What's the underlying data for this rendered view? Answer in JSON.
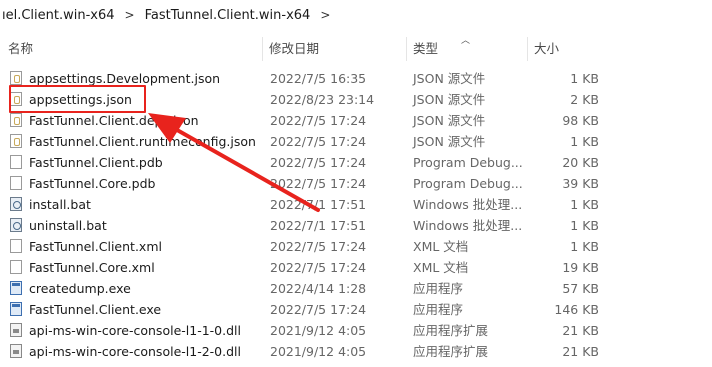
{
  "breadcrumb": {
    "items": [
      "ıel.Client.win-x64",
      "FastTunnel.Client.win-x64"
    ],
    "separators": [
      ">",
      ">"
    ]
  },
  "columns": {
    "name": "名称",
    "date": "修改日期",
    "type": "类型",
    "size": "大小"
  },
  "files": [
    {
      "name": "appsettings.Development.json",
      "date": "2022/7/5 16:35",
      "type": "JSON 源文件",
      "size": "1 KB",
      "icon": "json-file-icon"
    },
    {
      "name": "appsettings.json",
      "date": "2022/8/23 23:14",
      "type": "JSON 源文件",
      "size": "2 KB",
      "icon": "json-file-icon"
    },
    {
      "name": "FastTunnel.Client.deps.json",
      "date": "2022/7/5 17:24",
      "type": "JSON 源文件",
      "size": "98 KB",
      "icon": "json-file-icon"
    },
    {
      "name": "FastTunnel.Client.runtimeconfig.json",
      "date": "2022/7/5 17:24",
      "type": "JSON 源文件",
      "size": "1 KB",
      "icon": "json-file-icon"
    },
    {
      "name": "FastTunnel.Client.pdb",
      "date": "2022/7/5 17:24",
      "type": "Program Debug...",
      "size": "20 KB",
      "icon": "file-icon"
    },
    {
      "name": "FastTunnel.Core.pdb",
      "date": "2022/7/5 17:24",
      "type": "Program Debug...",
      "size": "39 KB",
      "icon": "file-icon"
    },
    {
      "name": "install.bat",
      "date": "2022/7/1 17:51",
      "type": "Windows 批处理...",
      "size": "1 KB",
      "icon": "bat-file-icon"
    },
    {
      "name": "uninstall.bat",
      "date": "2022/7/1 17:51",
      "type": "Windows 批处理...",
      "size": "1 KB",
      "icon": "bat-file-icon"
    },
    {
      "name": "FastTunnel.Client.xml",
      "date": "2022/7/5 17:24",
      "type": "XML 文档",
      "size": "1 KB",
      "icon": "file-icon"
    },
    {
      "name": "FastTunnel.Core.xml",
      "date": "2022/7/5 17:24",
      "type": "XML 文档",
      "size": "19 KB",
      "icon": "file-icon"
    },
    {
      "name": "createdump.exe",
      "date": "2022/4/14 1:28",
      "type": "应用程序",
      "size": "57 KB",
      "icon": "exe-file-icon"
    },
    {
      "name": "FastTunnel.Client.exe",
      "date": "2022/7/5 17:24",
      "type": "应用程序",
      "size": "146 KB",
      "icon": "exe-file-icon"
    },
    {
      "name": "api-ms-win-core-console-l1-1-0.dll",
      "date": "2021/9/12 4:05",
      "type": "应用程序扩展",
      "size": "21 KB",
      "icon": "dll-file-icon"
    },
    {
      "name": "api-ms-win-core-console-l1-2-0.dll",
      "date": "2021/9/12 4:05",
      "type": "应用程序扩展",
      "size": "21 KB",
      "icon": "dll-file-icon"
    }
  ],
  "annotation": {
    "color": "#e8231d",
    "highlighted_file": "appsettings.json"
  }
}
